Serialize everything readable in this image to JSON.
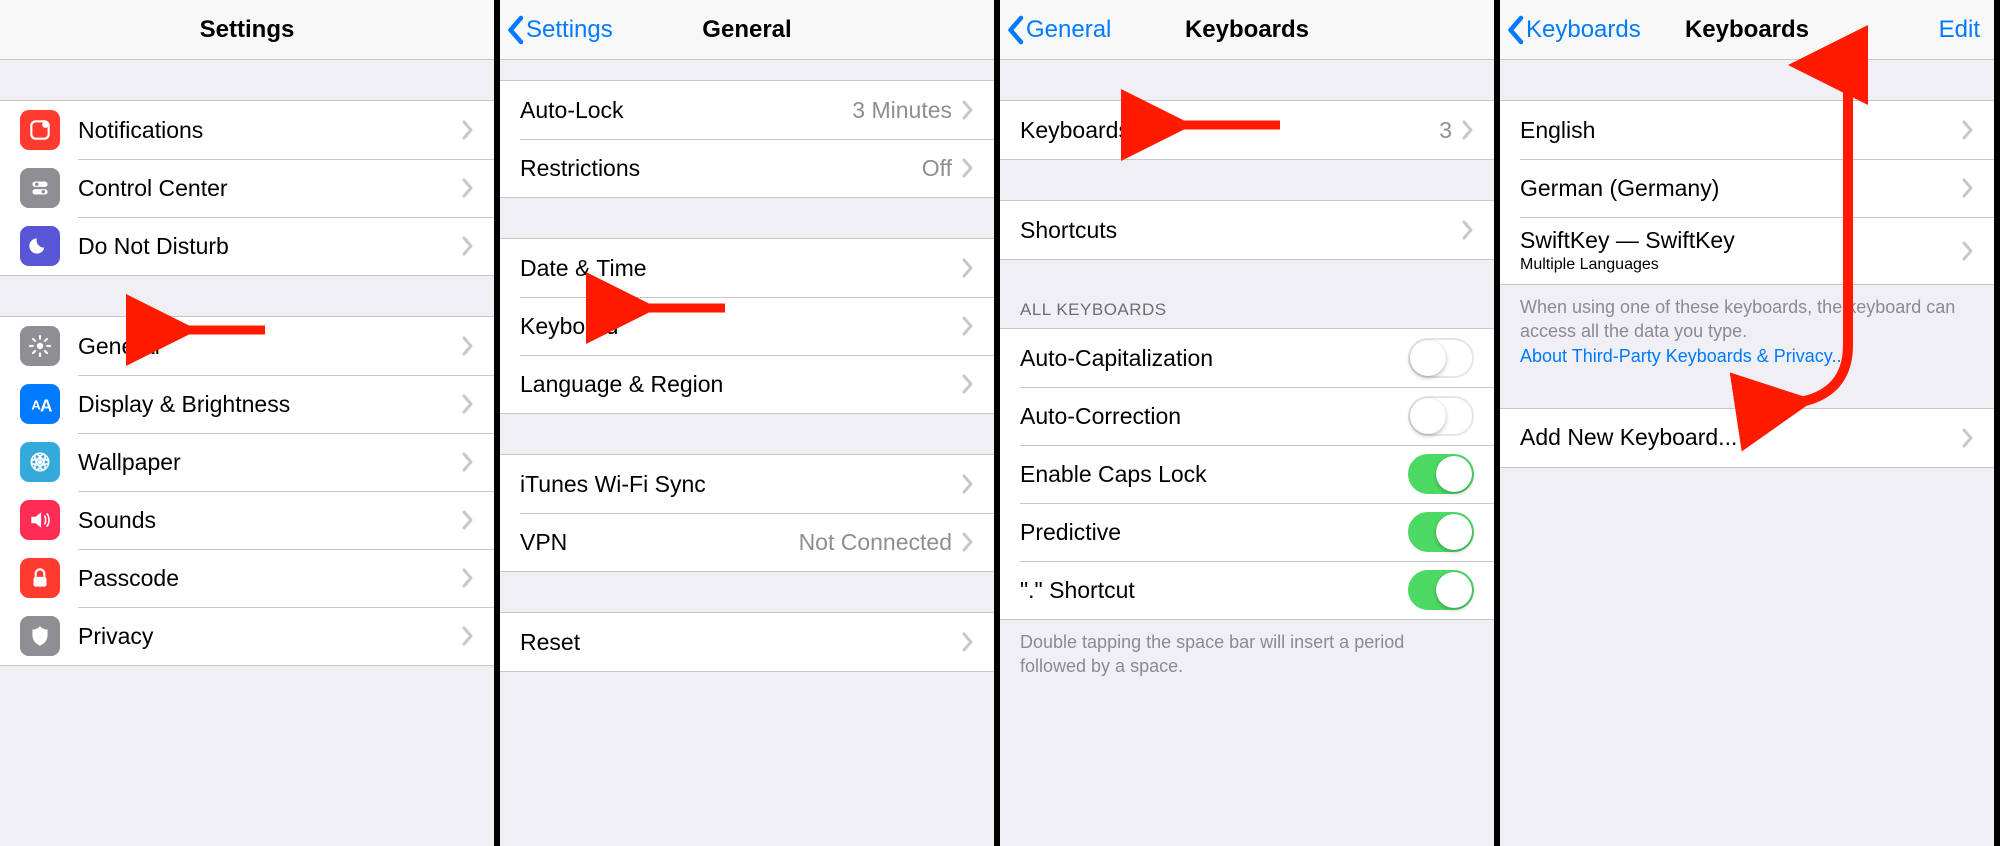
{
  "pane1": {
    "title": "Settings",
    "groupA": [
      {
        "name": "notifications",
        "label": "Notifications",
        "iconClass": "ic-red"
      },
      {
        "name": "control-center",
        "label": "Control Center",
        "iconClass": "ic-gray"
      },
      {
        "name": "do-not-disturb",
        "label": "Do Not Disturb",
        "iconClass": "ic-purple"
      }
    ],
    "groupB": [
      {
        "name": "general",
        "label": "General",
        "iconClass": "ic-gray"
      },
      {
        "name": "display",
        "label": "Display & Brightness",
        "iconClass": "ic-blue"
      },
      {
        "name": "wallpaper",
        "label": "Wallpaper",
        "iconClass": "ic-teal"
      },
      {
        "name": "sounds",
        "label": "Sounds",
        "iconClass": "ic-pink"
      },
      {
        "name": "passcode",
        "label": "Passcode",
        "iconClass": "ic-red"
      },
      {
        "name": "privacy",
        "label": "Privacy",
        "iconClass": "ic-gray"
      }
    ]
  },
  "pane2": {
    "back": "Settings",
    "title": "General",
    "groupA": [
      {
        "name": "auto-lock",
        "label": "Auto-Lock",
        "value": "3 Minutes"
      },
      {
        "name": "restrictions",
        "label": "Restrictions",
        "value": "Off"
      }
    ],
    "groupB": [
      {
        "name": "date-time",
        "label": "Date & Time"
      },
      {
        "name": "keyboard",
        "label": "Keyboard"
      },
      {
        "name": "language",
        "label": "Language & Region"
      }
    ],
    "groupC": [
      {
        "name": "itunes-sync",
        "label": "iTunes Wi-Fi Sync"
      },
      {
        "name": "vpn",
        "label": "VPN",
        "value": "Not Connected"
      }
    ],
    "groupD": [
      {
        "name": "reset",
        "label": "Reset"
      }
    ]
  },
  "pane3": {
    "back": "General",
    "title": "Keyboards",
    "groupA": [
      {
        "name": "keyboards-count",
        "label": "Keyboards",
        "value": "3"
      }
    ],
    "groupB": [
      {
        "name": "shortcuts",
        "label": "Shortcuts"
      }
    ],
    "sectionHeader": "ALL KEYBOARDS",
    "toggles": [
      {
        "name": "auto-cap",
        "label": "Auto-Capitalization",
        "on": false
      },
      {
        "name": "auto-correct",
        "label": "Auto-Correction",
        "on": false
      },
      {
        "name": "caps-lock",
        "label": "Enable Caps Lock",
        "on": true
      },
      {
        "name": "predictive",
        "label": "Predictive",
        "on": true
      },
      {
        "name": "dot-shortcut",
        "label": "\".\" Shortcut",
        "on": true
      }
    ],
    "footer": "Double tapping the space bar will insert a period followed by a space."
  },
  "pane4": {
    "back": "Keyboards",
    "title": "Keyboards",
    "edit": "Edit",
    "keyboards": [
      {
        "name": "kb-english",
        "label": "English"
      },
      {
        "name": "kb-german",
        "label": "German (Germany)"
      },
      {
        "name": "kb-swiftkey",
        "label": "SwiftKey — SwiftKey",
        "sublabel": "Multiple Languages"
      }
    ],
    "footerText": "When using one of these keyboards, the keyboard can access all the data you type.",
    "footerLink": "About Third-Party Keyboards & Privacy...",
    "addNew": "Add New Keyboard..."
  }
}
